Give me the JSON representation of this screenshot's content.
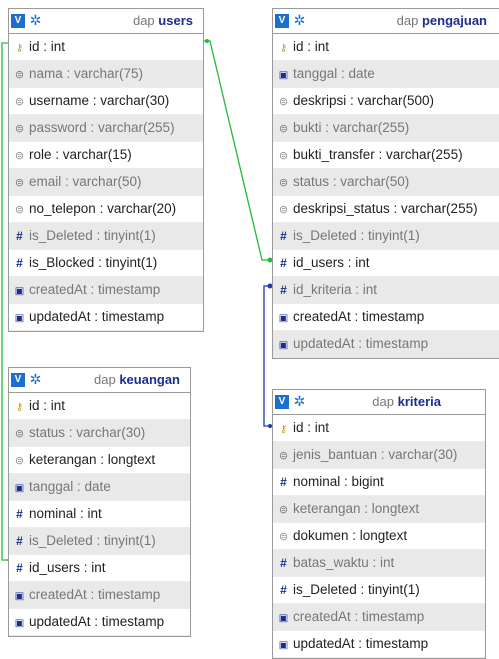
{
  "toggle_label": "V",
  "tables": {
    "users": {
      "prefix": "dap",
      "name": "users",
      "columns": [
        {
          "icon": "key",
          "text": "id : int",
          "nullable": false
        },
        {
          "icon": "text",
          "text": "nama : varchar(75)",
          "nullable": true
        },
        {
          "icon": "text",
          "text": "username : varchar(30)",
          "nullable": false
        },
        {
          "icon": "text",
          "text": "password : varchar(255)",
          "nullable": true
        },
        {
          "icon": "text",
          "text": "role : varchar(15)",
          "nullable": false
        },
        {
          "icon": "text",
          "text": "email : varchar(50)",
          "nullable": true
        },
        {
          "icon": "text",
          "text": "no_telepon : varchar(20)",
          "nullable": false
        },
        {
          "icon": "numeric",
          "text": "is_Deleted : tinyint(1)",
          "nullable": true
        },
        {
          "icon": "numeric",
          "text": "is_Blocked : tinyint(1)",
          "nullable": false
        },
        {
          "icon": "date",
          "text": "createdAt : timestamp",
          "nullable": true
        },
        {
          "icon": "date",
          "text": "updatedAt : timestamp",
          "nullable": false
        }
      ]
    },
    "pengajuan": {
      "prefix": "dap",
      "name": "pengajuan",
      "columns": [
        {
          "icon": "key",
          "text": "id : int",
          "nullable": false
        },
        {
          "icon": "date",
          "text": "tanggal : date",
          "nullable": true
        },
        {
          "icon": "text",
          "text": "deskripsi : varchar(500)",
          "nullable": false
        },
        {
          "icon": "text",
          "text": "bukti : varchar(255)",
          "nullable": true
        },
        {
          "icon": "text",
          "text": "bukti_transfer : varchar(255)",
          "nullable": false
        },
        {
          "icon": "text",
          "text": "status : varchar(50)",
          "nullable": true
        },
        {
          "icon": "text",
          "text": "deskripsi_status : varchar(255)",
          "nullable": false
        },
        {
          "icon": "numeric",
          "text": "is_Deleted : tinyint(1)",
          "nullable": true
        },
        {
          "icon": "numeric",
          "text": "id_users : int",
          "nullable": false
        },
        {
          "icon": "numeric",
          "text": "id_kriteria : int",
          "nullable": true
        },
        {
          "icon": "date",
          "text": "createdAt : timestamp",
          "nullable": false
        },
        {
          "icon": "date",
          "text": "updatedAt : timestamp",
          "nullable": true
        }
      ]
    },
    "keuangan": {
      "prefix": "dap",
      "name": "keuangan",
      "columns": [
        {
          "icon": "key",
          "text": "id : int",
          "nullable": false
        },
        {
          "icon": "text",
          "text": "status : varchar(30)",
          "nullable": true
        },
        {
          "icon": "text",
          "text": "keterangan : longtext",
          "nullable": false
        },
        {
          "icon": "date",
          "text": "tanggal : date",
          "nullable": true
        },
        {
          "icon": "numeric",
          "text": "nominal : int",
          "nullable": false
        },
        {
          "icon": "numeric",
          "text": "is_Deleted : tinyint(1)",
          "nullable": true
        },
        {
          "icon": "numeric",
          "text": "id_users : int",
          "nullable": false
        },
        {
          "icon": "date",
          "text": "createdAt : timestamp",
          "nullable": true
        },
        {
          "icon": "date",
          "text": "updatedAt : timestamp",
          "nullable": false
        }
      ]
    },
    "kriteria": {
      "prefix": "dap",
      "name": "kriteria",
      "columns": [
        {
          "icon": "key",
          "text": "id : int",
          "nullable": false
        },
        {
          "icon": "text",
          "text": "jenis_bantuan : varchar(30)",
          "nullable": true
        },
        {
          "icon": "numeric",
          "text": "nominal : bigint",
          "nullable": false
        },
        {
          "icon": "text",
          "text": "keterangan : longtext",
          "nullable": true
        },
        {
          "icon": "text",
          "text": "dokumen : longtext",
          "nullable": false
        },
        {
          "icon": "numeric",
          "text": "batas_waktu : int",
          "nullable": true
        },
        {
          "icon": "numeric",
          "text": "is_Deleted : tinyint(1)",
          "nullable": false
        },
        {
          "icon": "date",
          "text": "createdAt : timestamp",
          "nullable": true
        },
        {
          "icon": "date",
          "text": "updatedAt : timestamp",
          "nullable": false
        }
      ]
    }
  },
  "relation_colors": {
    "users": "#22bb33",
    "kriteria": "#1a3aa8"
  }
}
